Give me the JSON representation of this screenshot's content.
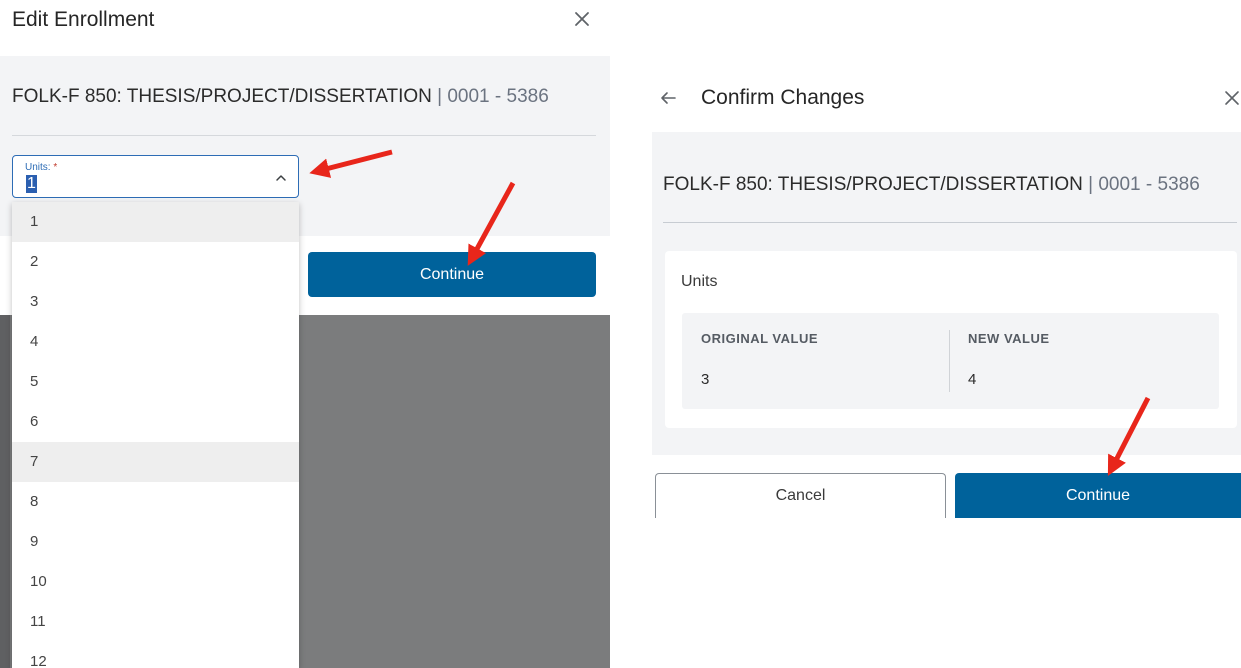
{
  "edit_dialog": {
    "title": "Edit Enrollment",
    "course": "FOLK-F 850: THESIS/PROJECT/DISSERTATION",
    "section": "| 0001 - 5386",
    "units_field": {
      "label": "Units:",
      "required_mark": "*",
      "value": "1",
      "options": [
        "1",
        "2",
        "3",
        "4",
        "5",
        "6",
        "7",
        "8",
        "9",
        "10",
        "11",
        "12"
      ]
    },
    "continue_label": "Continue",
    "icons": {
      "close": "close-icon",
      "chevron": "chevron-up-icon"
    }
  },
  "confirm_dialog": {
    "title": "Confirm Changes",
    "course": "FOLK-F 850: THESIS/PROJECT/DISSERTATION",
    "section": "| 0001 - 5386",
    "change": {
      "field": "Units",
      "original_label": "ORIGINAL VALUE",
      "original_value": "3",
      "new_label": "NEW VALUE",
      "new_value": "4"
    },
    "cancel_label": "Cancel",
    "continue_label": "Continue",
    "icons": {
      "back": "arrow-left-icon",
      "close": "close-icon"
    }
  },
  "colors": {
    "primary_button": "#00629b",
    "panel_background": "#f3f4f6",
    "overlay": "#7b7c7d",
    "focus_border": "#2d6cb5",
    "annotation_arrow": "#e8261b"
  }
}
